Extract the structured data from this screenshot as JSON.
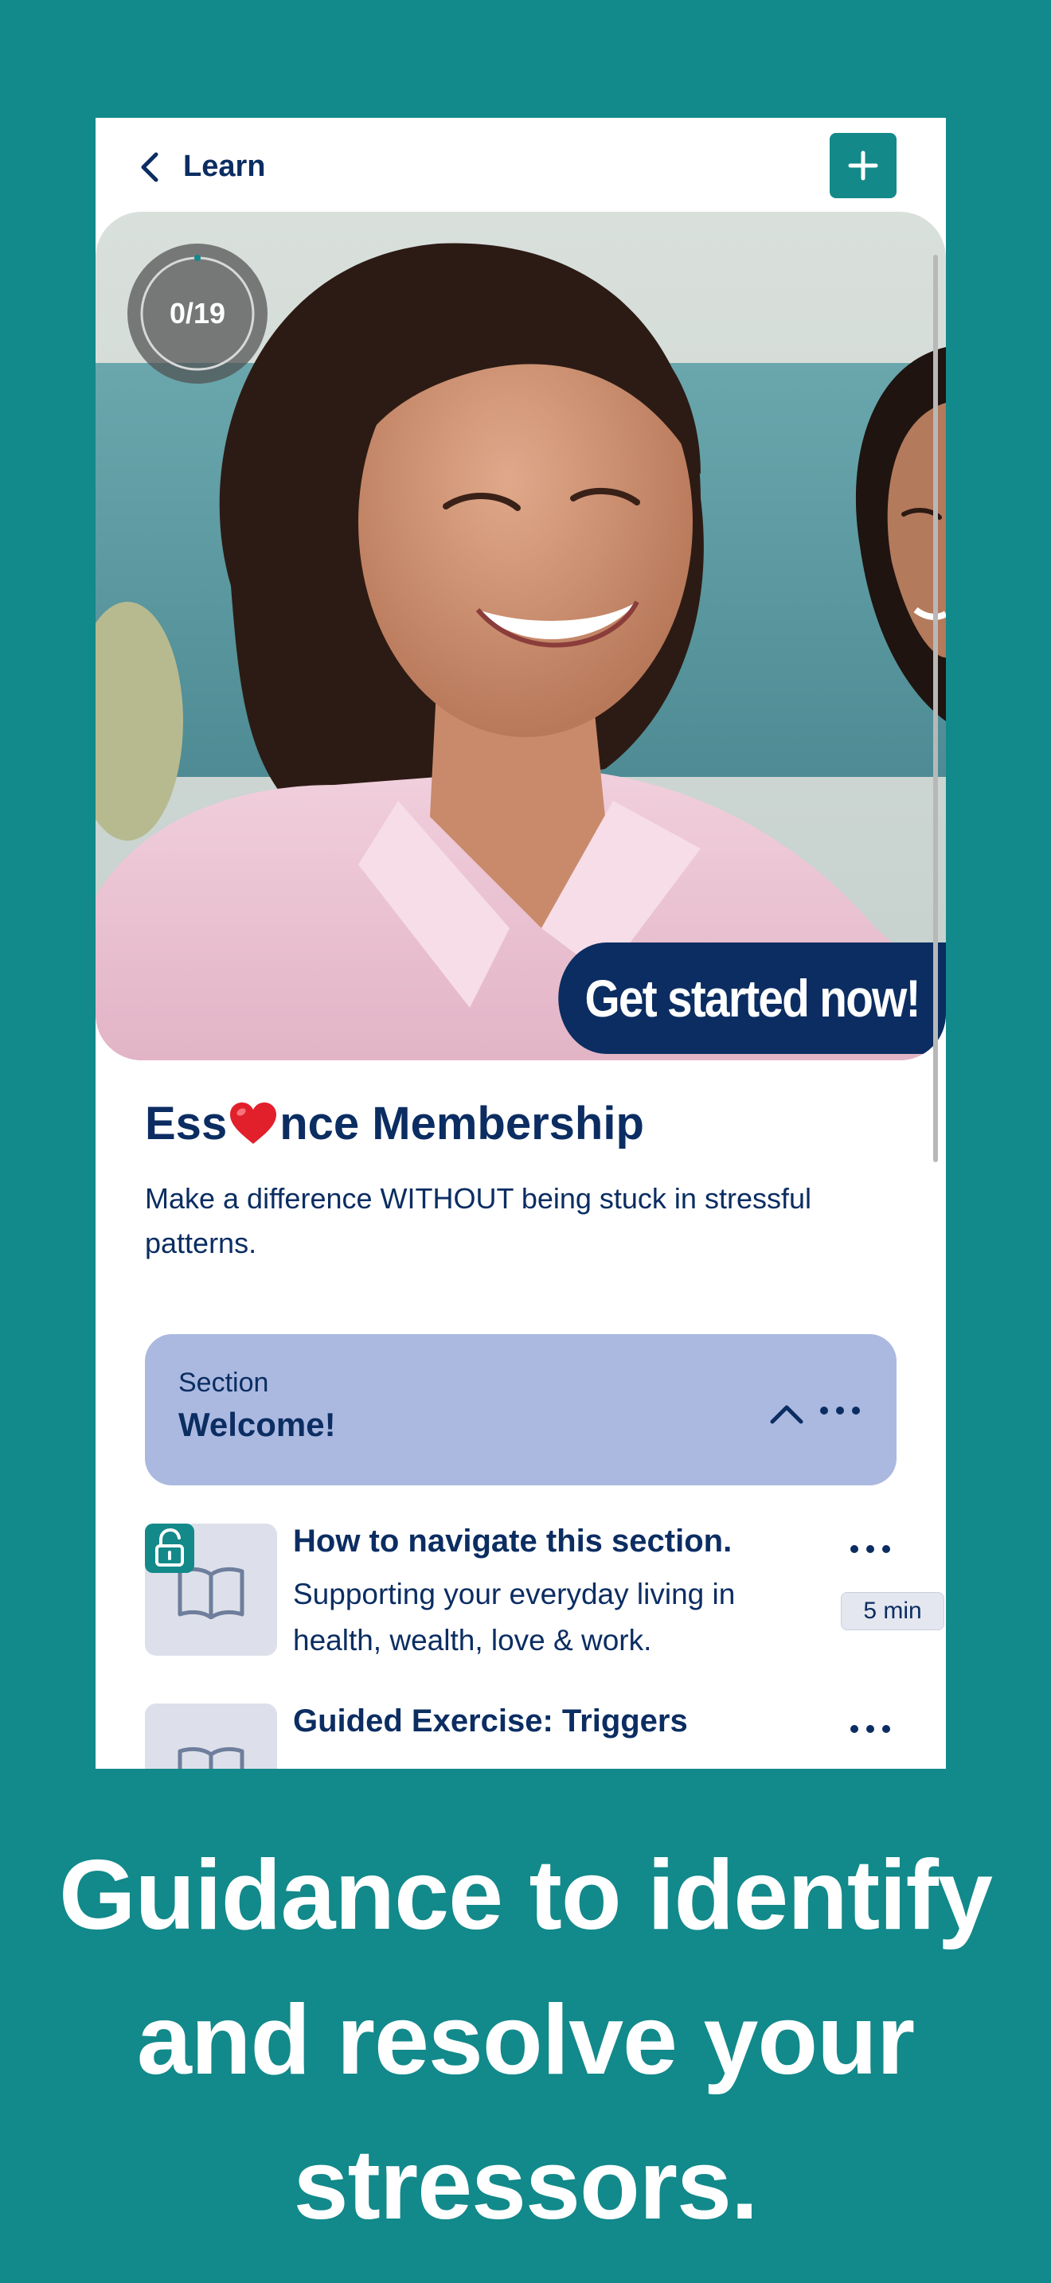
{
  "header": {
    "back_icon": "chevron-left-icon",
    "title": "Learn",
    "add_icon": "plus-icon"
  },
  "hero": {
    "progress": {
      "completed": 0,
      "total": 19,
      "label": "0/19"
    },
    "cta_label": "Get started now!"
  },
  "course": {
    "title_prefix": "Ess",
    "title_icon": "heart-icon",
    "title_suffix": "nce Membership",
    "description": "Make a difference WITHOUT being stuck in stressful patterns."
  },
  "section": {
    "label": "Section",
    "title": "Welcome!",
    "collapse_icon": "chevron-up-icon",
    "more_icon": "more-horizontal-icon"
  },
  "lessons": [
    {
      "title": "How to navigate this section.",
      "description": "Supporting your everyday living in health, wealth, love & work.",
      "duration": "5 min",
      "status_icon": "unlock-icon",
      "thumb_icon": "book-icon"
    },
    {
      "title": "Guided Exercise: Triggers",
      "thumb_icon": "book-icon"
    }
  ],
  "caption": {
    "line1": "Guidance to identify",
    "line2": "and resolve your",
    "line3": "stressors."
  },
  "colors": {
    "background": "#12898a",
    "primary": "#0b2d62",
    "accent": "#13898a",
    "section_bg": "#abb9e0"
  }
}
